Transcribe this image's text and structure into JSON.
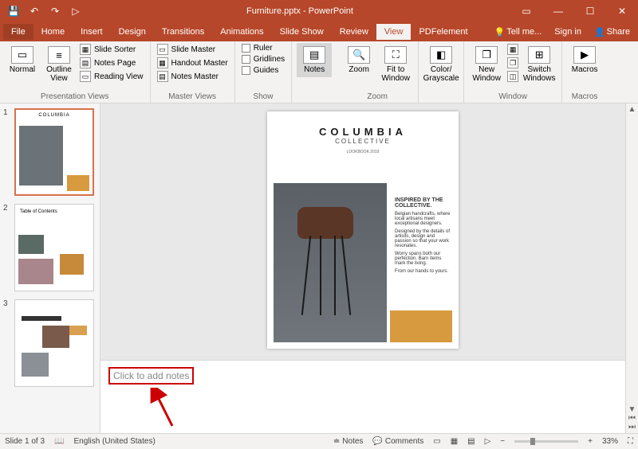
{
  "app": {
    "title": "Furniture.pptx - PowerPoint"
  },
  "qat": {
    "save": "💾",
    "undo": "↶",
    "redo": "↷",
    "start": "▷"
  },
  "wincontrols": {
    "opts": "▭",
    "min": "—",
    "max": "☐",
    "close": "✕"
  },
  "tabs": {
    "file": "File",
    "home": "Home",
    "insert": "Insert",
    "design": "Design",
    "transitions": "Transitions",
    "animations": "Animations",
    "slideshow": "Slide Show",
    "review": "Review",
    "view": "View",
    "pdfelement": "PDFelement"
  },
  "tabs_right": {
    "tellme": "Tell me...",
    "signin": "Sign in",
    "share": "Share"
  },
  "ribbon": {
    "presentation_views": {
      "label": "Presentation Views",
      "normal": "Normal",
      "outline": "Outline View",
      "slide_sorter": "Slide Sorter",
      "notes_page": "Notes Page",
      "reading_view": "Reading View"
    },
    "master_views": {
      "label": "Master Views",
      "slide_master": "Slide Master",
      "handout_master": "Handout Master",
      "notes_master": "Notes Master"
    },
    "show": {
      "label": "Show",
      "ruler": "Ruler",
      "gridlines": "Gridlines",
      "guides": "Guides"
    },
    "notes": "Notes",
    "zoom": {
      "label": "Zoom",
      "zoom": "Zoom",
      "fit": "Fit to Window"
    },
    "color": {
      "label": "",
      "color_grayscale": "Color/ Grayscale"
    },
    "window": {
      "label": "Window",
      "new_window": "New Window",
      "switch": "Switch Windows"
    },
    "macros": {
      "label": "Macros",
      "macros": "Macros"
    }
  },
  "slides": [
    1,
    2,
    3
  ],
  "slide_content": {
    "title": "COLUMBIA",
    "subtitle": "COLLECTIVE",
    "lookbook": "LOOKBOOK 2019",
    "inspired_h": "INSPIRED BY THE COLLECTIVE.",
    "body1": "Belgian handcrafts, where local artisans meet exceptional designers.",
    "body2": "Designed by the details of artisits, design and passion so that your work resonates.",
    "body3": "Worry spans both our perfection. Barn items mark the living.",
    "body4": "From our hands to yours."
  },
  "thumb2": {
    "title": "Table of Contents"
  },
  "notes": {
    "placeholder": "Click to add notes"
  },
  "status": {
    "slide": "Slide 1 of 3",
    "lang": "English (United States)",
    "notes": "Notes",
    "comments": "Comments",
    "zoom": "33%"
  }
}
